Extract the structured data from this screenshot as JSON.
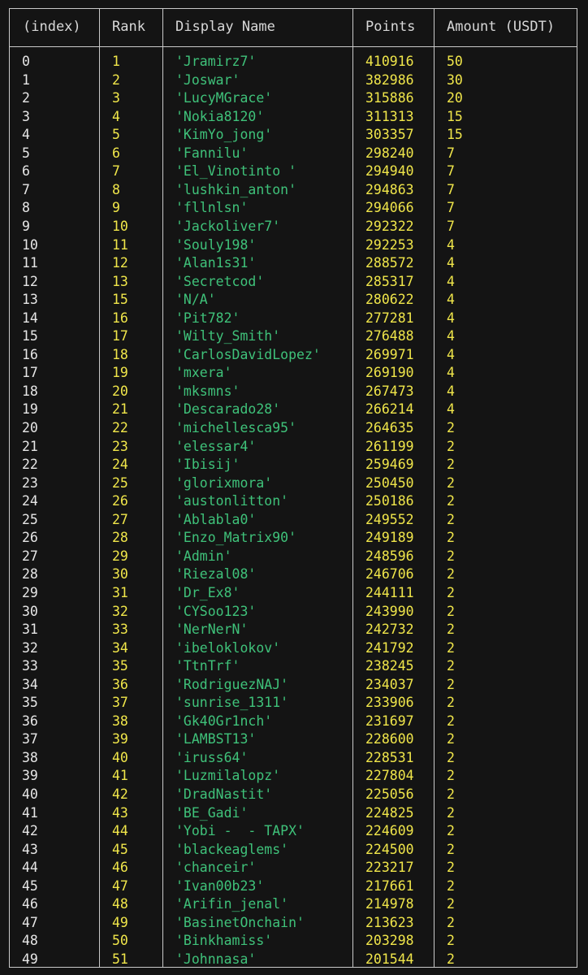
{
  "columns": {
    "index": "(index)",
    "rank": "Rank",
    "display_name": "Display Name",
    "points": "Points",
    "amount": "Amount (USDT)"
  },
  "rows": [
    {
      "index": "0",
      "rank": "1",
      "name": "'Jramirz7'",
      "points": "410916",
      "amount": "50"
    },
    {
      "index": "1",
      "rank": "2",
      "name": "'Joswar'",
      "points": "382986",
      "amount": "30"
    },
    {
      "index": "2",
      "rank": "3",
      "name": "'LucyMGrace'",
      "points": "315886",
      "amount": "20"
    },
    {
      "index": "3",
      "rank": "4",
      "name": "'Nokia8120'",
      "points": "311313",
      "amount": "15"
    },
    {
      "index": "4",
      "rank": "5",
      "name": "'KimYo_jong'",
      "points": "303357",
      "amount": "15"
    },
    {
      "index": "5",
      "rank": "6",
      "name": "'Fannilu'",
      "points": "298240",
      "amount": "7"
    },
    {
      "index": "6",
      "rank": "7",
      "name": "'El_Vinotinto '",
      "points": "294940",
      "amount": "7"
    },
    {
      "index": "7",
      "rank": "8",
      "name": "'lushkin_anton'",
      "points": "294863",
      "amount": "7"
    },
    {
      "index": "8",
      "rank": "9",
      "name": "'fllnlsn'",
      "points": "294066",
      "amount": "7"
    },
    {
      "index": "9",
      "rank": "10",
      "name": "'Jackoliver7'",
      "points": "292322",
      "amount": "7"
    },
    {
      "index": "10",
      "rank": "11",
      "name": "'Souly198'",
      "points": "292253",
      "amount": "4"
    },
    {
      "index": "11",
      "rank": "12",
      "name": "'Alan1s31'",
      "points": "288572",
      "amount": "4"
    },
    {
      "index": "12",
      "rank": "13",
      "name": "'Secretcod'",
      "points": "285317",
      "amount": "4"
    },
    {
      "index": "13",
      "rank": "15",
      "name": "'N/A'",
      "points": "280622",
      "amount": "4"
    },
    {
      "index": "14",
      "rank": "16",
      "name": "'Pit782'",
      "points": "277281",
      "amount": "4"
    },
    {
      "index": "15",
      "rank": "17",
      "name": "'Wilty_Smith'",
      "points": "276488",
      "amount": "4"
    },
    {
      "index": "16",
      "rank": "18",
      "name": "'CarlosDavidLopez'",
      "points": "269971",
      "amount": "4"
    },
    {
      "index": "17",
      "rank": "19",
      "name": "'mxera'",
      "points": "269190",
      "amount": "4"
    },
    {
      "index": "18",
      "rank": "20",
      "name": "'mksmns'",
      "points": "267473",
      "amount": "4"
    },
    {
      "index": "19",
      "rank": "21",
      "name": "'Descarado28'",
      "points": "266214",
      "amount": "4"
    },
    {
      "index": "20",
      "rank": "22",
      "name": "'michellesca95'",
      "points": "264635",
      "amount": "2"
    },
    {
      "index": "21",
      "rank": "23",
      "name": "'elessar4'",
      "points": "261199",
      "amount": "2"
    },
    {
      "index": "22",
      "rank": "24",
      "name": "'Ibisij'",
      "points": "259469",
      "amount": "2"
    },
    {
      "index": "23",
      "rank": "25",
      "name": "'glorixmora'",
      "points": "250450",
      "amount": "2"
    },
    {
      "index": "24",
      "rank": "26",
      "name": "'austonlitton'",
      "points": "250186",
      "amount": "2"
    },
    {
      "index": "25",
      "rank": "27",
      "name": "'Ablabla0'",
      "points": "249552",
      "amount": "2"
    },
    {
      "index": "26",
      "rank": "28",
      "name": "'Enzo_Matrix90'",
      "points": "249189",
      "amount": "2"
    },
    {
      "index": "27",
      "rank": "29",
      "name": "'Admin'",
      "points": "248596",
      "amount": "2"
    },
    {
      "index": "28",
      "rank": "30",
      "name": "'Riezal08'",
      "points": "246706",
      "amount": "2"
    },
    {
      "index": "29",
      "rank": "31",
      "name": "'Dr_Ex8'",
      "points": "244111",
      "amount": "2"
    },
    {
      "index": "30",
      "rank": "32",
      "name": "'CYSoo123'",
      "points": "243990",
      "amount": "2"
    },
    {
      "index": "31",
      "rank": "33",
      "name": "'NerNerN'",
      "points": "242732",
      "amount": "2"
    },
    {
      "index": "32",
      "rank": "34",
      "name": "'ibeloklokov'",
      "points": "241792",
      "amount": "2"
    },
    {
      "index": "33",
      "rank": "35",
      "name": "'TtnTrf'",
      "points": "238245",
      "amount": "2"
    },
    {
      "index": "34",
      "rank": "36",
      "name": "'RodriguezNAJ'",
      "points": "234037",
      "amount": "2"
    },
    {
      "index": "35",
      "rank": "37",
      "name": "'sunrise_1311'",
      "points": "233906",
      "amount": "2"
    },
    {
      "index": "36",
      "rank": "38",
      "name": "'Gk40Gr1nch'",
      "points": "231697",
      "amount": "2"
    },
    {
      "index": "37",
      "rank": "39",
      "name": "'LAMBST13'",
      "points": "228600",
      "amount": "2"
    },
    {
      "index": "38",
      "rank": "40",
      "name": "'iruss64'",
      "points": "228531",
      "amount": "2"
    },
    {
      "index": "39",
      "rank": "41",
      "name": "'Luzmilalopz'",
      "points": "227804",
      "amount": "2"
    },
    {
      "index": "40",
      "rank": "42",
      "name": "'DradNastit'",
      "points": "225056",
      "amount": "2"
    },
    {
      "index": "41",
      "rank": "43",
      "name": "'BE_Gadi'",
      "points": "224825",
      "amount": "2"
    },
    {
      "index": "42",
      "rank": "44",
      "name": "'Yobi -  - TAPX'",
      "points": "224609",
      "amount": "2"
    },
    {
      "index": "43",
      "rank": "45",
      "name": "'blackeaglems'",
      "points": "224500",
      "amount": "2"
    },
    {
      "index": "44",
      "rank": "46",
      "name": "'chanceir'",
      "points": "223217",
      "amount": "2"
    },
    {
      "index": "45",
      "rank": "47",
      "name": "'Ivan00b23'",
      "points": "217661",
      "amount": "2"
    },
    {
      "index": "46",
      "rank": "48",
      "name": "'Arifin_jenal'",
      "points": "214978",
      "amount": "2"
    },
    {
      "index": "47",
      "rank": "49",
      "name": "'BasinetOnchain'",
      "points": "213623",
      "amount": "2"
    },
    {
      "index": "48",
      "rank": "50",
      "name": "'Binkhamiss'",
      "points": "203298",
      "amount": "2"
    },
    {
      "index": "49",
      "rank": "51",
      "name": "'Johnnasa'",
      "points": "201544",
      "amount": "2"
    }
  ]
}
